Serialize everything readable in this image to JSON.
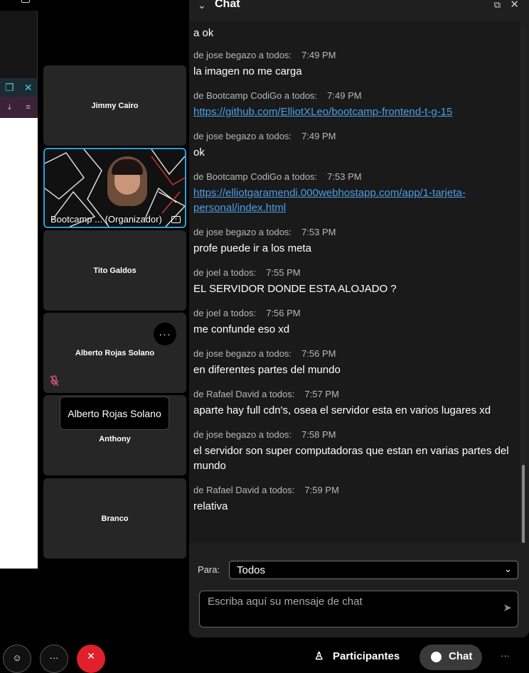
{
  "chat": {
    "title": "Chat",
    "messages_first": "a ok",
    "messages": [
      {
        "sender": "de jose begazo a todos:",
        "time": "7:49 PM",
        "text": "la imagen no me carga",
        "link": false
      },
      {
        "sender": "de Bootcamp CodiGo a todos:",
        "time": "7:49 PM",
        "text": "https://github.com/ElliotXLeo/bootcamp-frontend-t-g-15",
        "link": true
      },
      {
        "sender": "de jose begazo a todos:",
        "time": "7:49 PM",
        "text": "ok",
        "link": false
      },
      {
        "sender": "de Bootcamp CodiGo a todos:",
        "time": "7:53 PM",
        "text": "https://elliotgaramendi.000webhostapp.com/app/1-tarjeta-personal/index.html",
        "link": true
      },
      {
        "sender": "de jose begazo a todos:",
        "time": "7:53 PM",
        "text": "profe puede ir a los meta",
        "link": false
      },
      {
        "sender": "de joel a todos:",
        "time": "7:55 PM",
        "text": "EL SERVIDOR DONDE ESTA ALOJADO ?",
        "link": false
      },
      {
        "sender": "de joel a todos:",
        "time": "7:56 PM",
        "text": "me confunde eso xd",
        "link": false
      },
      {
        "sender": "de jose begazo a todos:",
        "time": "7:56 PM",
        "text": "en diferentes partes del mundo",
        "link": false
      },
      {
        "sender": "de Rafael David a todos:",
        "time": "7:57 PM",
        "text": "aparte hay full cdn's, osea el servidor esta en varios lugares xd",
        "link": false
      },
      {
        "sender": "de jose begazo a todos:",
        "time": "7:58 PM",
        "text": "el servidor son super computadoras que estan en varias partes del mundo",
        "link": false
      },
      {
        "sender": "de Rafael David a todos:",
        "time": "7:59 PM",
        "text": "relativa",
        "link": false
      }
    ],
    "to_label": "Para:",
    "to_value": "Todos",
    "compose_placeholder": "Escriba aquí su mensaje de chat"
  },
  "participants": {
    "tile1": "Jimmy Cairo",
    "tile2": "Bootcamp ... (Organizador)",
    "tile3": "Tito Galdos",
    "tile4": "Alberto Rojas Solano",
    "tile5": "Anthony",
    "tile6": "Branco",
    "tooltip": "Alberto Rojas Solano",
    "more_glyph": "···"
  },
  "bottom_bar": {
    "participants_label": "Participantes",
    "chat_label": "Chat",
    "more_glyph": "···"
  },
  "colors": {
    "accent_blue": "#2d9fe0",
    "end_call_red": "#e0202a",
    "link_blue": "#4a9fe8"
  }
}
